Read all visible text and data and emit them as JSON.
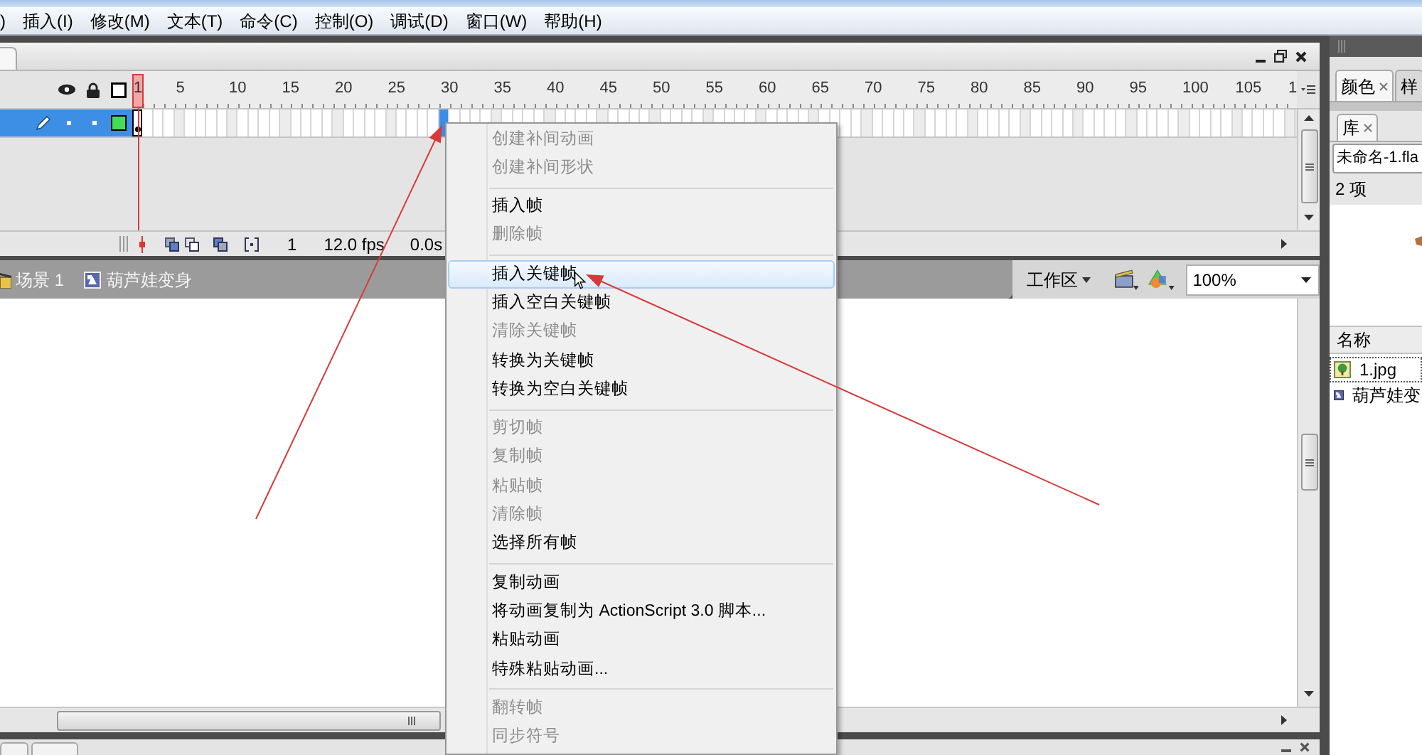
{
  "menu_bar": {
    "items": [
      ")",
      "插入(I)",
      "修改(M)",
      "文本(T)",
      "命令(C)",
      "控制(O)",
      "调试(D)",
      "窗口(W)",
      "帮助(H)"
    ]
  },
  "timeline": {
    "ruler_labels": [
      "1",
      "5",
      "10",
      "15",
      "20",
      "25",
      "30",
      "35",
      "40",
      "45",
      "50",
      "55",
      "60",
      "65",
      "70",
      "75",
      "80",
      "85",
      "90",
      "95",
      "100",
      "105",
      "1"
    ],
    "layers": [
      {
        "selected": true,
        "color": "#44dd55",
        "frames": [
          {
            "keyframe": true,
            "selected": false
          },
          {
            "keyframe": false,
            "selected": false
          },
          {
            "keyframe": false,
            "selected": false
          },
          {
            "keyframe": false,
            "selected": false
          },
          {
            "keyframe": false,
            "selected": false
          },
          {
            "keyframe": false,
            "selected": false
          },
          {
            "keyframe": false,
            "selected": false
          },
          {
            "keyframe": false,
            "selected": false
          },
          {
            "keyframe": false,
            "selected": false
          },
          {
            "keyframe": false,
            "selected": false
          },
          {
            "keyframe": false,
            "selected": false
          },
          {
            "keyframe": false,
            "selected": false
          },
          {
            "keyframe": false,
            "selected": false
          },
          {
            "keyframe": false,
            "selected": false
          },
          {
            "keyframe": false,
            "selected": false
          },
          {
            "keyframe": false,
            "selected": false
          },
          {
            "keyframe": false,
            "selected": false
          },
          {
            "keyframe": false,
            "selected": false
          },
          {
            "keyframe": false,
            "selected": false
          },
          {
            "keyframe": false,
            "selected": false
          },
          {
            "keyframe": false,
            "selected": false
          },
          {
            "keyframe": false,
            "selected": false
          },
          {
            "keyframe": false,
            "selected": false
          },
          {
            "keyframe": false,
            "selected": false
          },
          {
            "keyframe": false,
            "selected": false
          },
          {
            "keyframe": false,
            "selected": false
          },
          {
            "keyframe": false,
            "selected": false
          },
          {
            "keyframe": false,
            "selected": false
          },
          {
            "keyframe": false,
            "selected": false
          },
          {
            "keyframe": false,
            "selected": true
          },
          {
            "keyframe": false,
            "selected": false
          },
          {
            "keyframe": false,
            "selected": false
          },
          {
            "keyframe": false,
            "selected": false
          },
          {
            "keyframe": false,
            "selected": false
          },
          {
            "keyframe": false,
            "selected": false
          },
          {
            "keyframe": false,
            "selected": false
          },
          {
            "keyframe": false,
            "selected": false
          },
          {
            "keyframe": false,
            "selected": false
          },
          {
            "keyframe": false,
            "selected": false
          },
          {
            "keyframe": false,
            "selected": false
          },
          {
            "keyframe": false,
            "selected": false
          },
          {
            "keyframe": false,
            "selected": false
          },
          {
            "keyframe": false,
            "selected": false
          },
          {
            "keyframe": false,
            "selected": false
          },
          {
            "keyframe": false,
            "selected": false
          },
          {
            "keyframe": false,
            "selected": false
          },
          {
            "keyframe": false,
            "selected": false
          },
          {
            "keyframe": false,
            "selected": false
          },
          {
            "keyframe": false,
            "selected": false
          },
          {
            "keyframe": false,
            "selected": false
          },
          {
            "keyframe": false,
            "selected": false
          },
          {
            "keyframe": false,
            "selected": false
          },
          {
            "keyframe": false,
            "selected": false
          },
          {
            "keyframe": false,
            "selected": false
          },
          {
            "keyframe": false,
            "selected": false
          },
          {
            "keyframe": false,
            "selected": false
          },
          {
            "keyframe": false,
            "selected": false
          },
          {
            "keyframe": false,
            "selected": false
          },
          {
            "keyframe": false,
            "selected": false
          },
          {
            "keyframe": false,
            "selected": false
          },
          {
            "keyframe": false,
            "selected": false
          },
          {
            "keyframe": false,
            "selected": false
          },
          {
            "keyframe": false,
            "selected": false
          },
          {
            "keyframe": false,
            "selected": false
          },
          {
            "keyframe": false,
            "selected": false
          },
          {
            "keyframe": false,
            "selected": false
          },
          {
            "keyframe": false,
            "selected": false
          },
          {
            "keyframe": false,
            "selected": false
          },
          {
            "keyframe": false,
            "selected": false
          },
          {
            "keyframe": false,
            "selected": false
          },
          {
            "keyframe": false,
            "selected": false
          },
          {
            "keyframe": false,
            "selected": false
          },
          {
            "keyframe": false,
            "selected": false
          },
          {
            "keyframe": false,
            "selected": false
          },
          {
            "keyframe": false,
            "selected": false
          },
          {
            "keyframe": false,
            "selected": false
          },
          {
            "keyframe": false,
            "selected": false
          },
          {
            "keyframe": false,
            "selected": false
          },
          {
            "keyframe": false,
            "selected": false
          },
          {
            "keyframe": false,
            "selected": false
          },
          {
            "keyframe": false,
            "selected": false
          },
          {
            "keyframe": false,
            "selected": false
          },
          {
            "keyframe": false,
            "selected": false
          },
          {
            "keyframe": false,
            "selected": false
          },
          {
            "keyframe": false,
            "selected": false
          },
          {
            "keyframe": false,
            "selected": false
          },
          {
            "keyframe": false,
            "selected": false
          },
          {
            "keyframe": false,
            "selected": false
          },
          {
            "keyframe": false,
            "selected": false
          },
          {
            "keyframe": false,
            "selected": false
          },
          {
            "keyframe": false,
            "selected": false
          },
          {
            "keyframe": false,
            "selected": false
          },
          {
            "keyframe": false,
            "selected": false
          },
          {
            "keyframe": false,
            "selected": false
          },
          {
            "keyframe": false,
            "selected": false
          },
          {
            "keyframe": false,
            "selected": false
          },
          {
            "keyframe": false,
            "selected": false
          },
          {
            "keyframe": false,
            "selected": false
          },
          {
            "keyframe": false,
            "selected": false
          },
          {
            "keyframe": false,
            "selected": false
          },
          {
            "keyframe": false,
            "selected": false
          },
          {
            "keyframe": false,
            "selected": false
          },
          {
            "keyframe": false,
            "selected": false
          },
          {
            "keyframe": false,
            "selected": false
          },
          {
            "keyframe": false,
            "selected": false
          },
          {
            "keyframe": false,
            "selected": false
          },
          {
            "keyframe": false,
            "selected": false
          },
          {
            "keyframe": false,
            "selected": false
          },
          {
            "keyframe": false,
            "selected": false
          },
          {
            "keyframe": false,
            "selected": false
          }
        ]
      }
    ],
    "status": {
      "current_frame": "1",
      "frame_rate": "12.0 fps",
      "elapsed_time": "0.0s"
    }
  },
  "edit_bar": {
    "scene": "场景 1",
    "symbol": "葫芦娃变身",
    "workspace": "工作区",
    "zoom": "100%"
  },
  "context_menu": {
    "items": [
      {
        "kind": "item",
        "label": "创建补间动画",
        "disabled": true,
        "selected": false
      },
      {
        "kind": "item",
        "label": "创建补间形状",
        "disabled": true,
        "selected": false
      },
      {
        "kind": "separator"
      },
      {
        "kind": "item",
        "label": "插入帧",
        "disabled": false,
        "selected": false
      },
      {
        "kind": "item",
        "label": "删除帧",
        "disabled": true,
        "selected": false
      },
      {
        "kind": "separator"
      },
      {
        "kind": "item",
        "label": "插入关键帧",
        "disabled": false,
        "selected": true
      },
      {
        "kind": "item",
        "label": "插入空白关键帧",
        "disabled": false,
        "selected": false
      },
      {
        "kind": "item",
        "label": "清除关键帧",
        "disabled": true,
        "selected": false
      },
      {
        "kind": "item",
        "label": "转换为关键帧",
        "disabled": false,
        "selected": false
      },
      {
        "kind": "item",
        "label": "转换为空白关键帧",
        "disabled": false,
        "selected": false
      },
      {
        "kind": "separator"
      },
      {
        "kind": "item",
        "label": "剪切帧",
        "disabled": true,
        "selected": false
      },
      {
        "kind": "item",
        "label": "复制帧",
        "disabled": true,
        "selected": false
      },
      {
        "kind": "item",
        "label": "粘贴帧",
        "disabled": true,
        "selected": false
      },
      {
        "kind": "item",
        "label": "清除帧",
        "disabled": true,
        "selected": false
      },
      {
        "kind": "item",
        "label": "选择所有帧",
        "disabled": false,
        "selected": false
      },
      {
        "kind": "separator"
      },
      {
        "kind": "item",
        "label": "复制动画",
        "disabled": false,
        "selected": false
      },
      {
        "kind": "item",
        "label": "将动画复制为 ActionScript 3.0 脚本...",
        "disabled": false,
        "selected": false
      },
      {
        "kind": "item",
        "label": "粘贴动画",
        "disabled": false,
        "selected": false
      },
      {
        "kind": "item",
        "label": "特殊粘贴动画...",
        "disabled": false,
        "selected": false
      },
      {
        "kind": "separator"
      },
      {
        "kind": "item",
        "label": "翻转帧",
        "disabled": true,
        "selected": false
      },
      {
        "kind": "item",
        "label": "同步符号",
        "disabled": true,
        "selected": false
      }
    ]
  },
  "right_panel": {
    "tabs": [
      {
        "label": "颜色",
        "selected": true,
        "closable": true
      },
      {
        "label": "样",
        "selected": false,
        "closable": false
      }
    ],
    "library": {
      "tabs": [
        {
          "label": "库",
          "selected": true,
          "closable": true
        }
      ],
      "document": "未命名-1.fla",
      "item_count": "2 项",
      "column": "名称",
      "items": [
        {
          "kind": "bitmap",
          "name": "1.jpg",
          "focused": true
        },
        {
          "kind": "movie_clip",
          "name": "葫芦娃变",
          "focused": false
        }
      ]
    }
  }
}
